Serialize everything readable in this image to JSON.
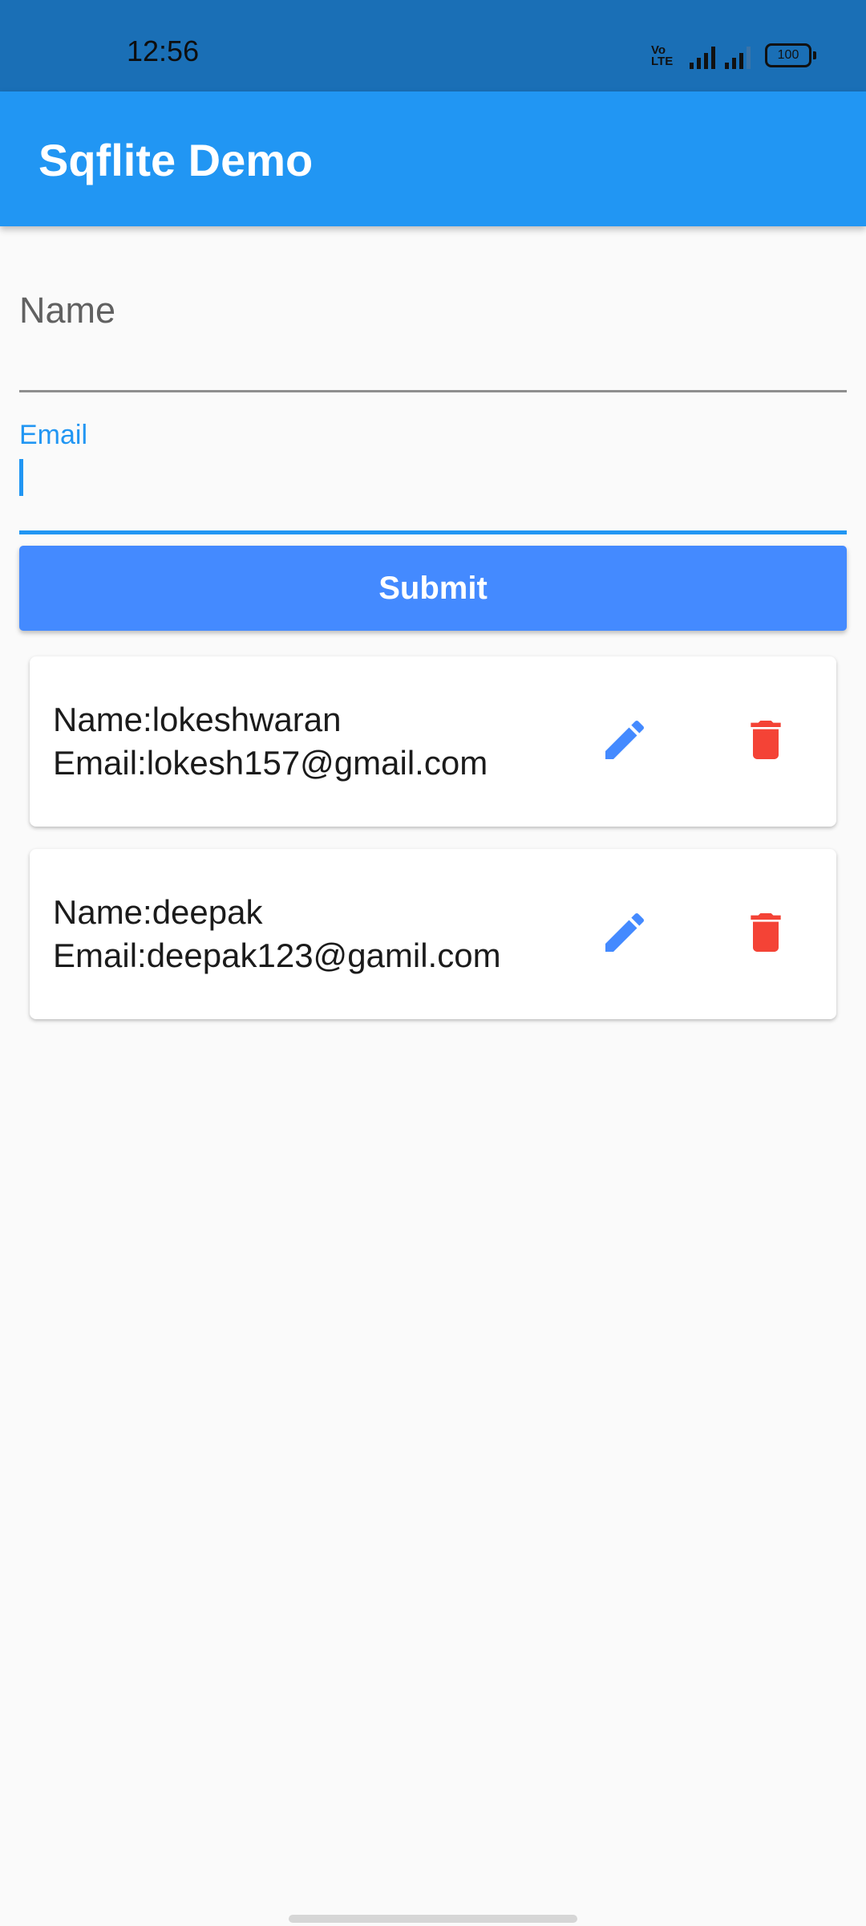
{
  "status_bar": {
    "time": "12:56",
    "volte_line1": "Vo",
    "volte_line2": "LTE",
    "battery": "100"
  },
  "app_bar": {
    "title": "Sqflite Demo"
  },
  "form": {
    "name_placeholder": "Name",
    "email_label": "Email",
    "email_value": "",
    "submit_label": "Submit"
  },
  "records": [
    {
      "name_line": "Name:lokeshwaran",
      "email_line": "Email:lokesh157@gmail.com"
    },
    {
      "name_line": "Name:deepak",
      "email_line": "Email:deepak123@gamil.com"
    }
  ],
  "icons": {
    "edit": "pencil-icon",
    "delete": "trash-icon"
  },
  "colors": {
    "status_bar": "#1a6fb6",
    "app_bar": "#2196f3",
    "submit_button": "#448aff",
    "edit_icon": "#448aff",
    "delete_icon": "#f44336",
    "background": "#fafafa"
  }
}
